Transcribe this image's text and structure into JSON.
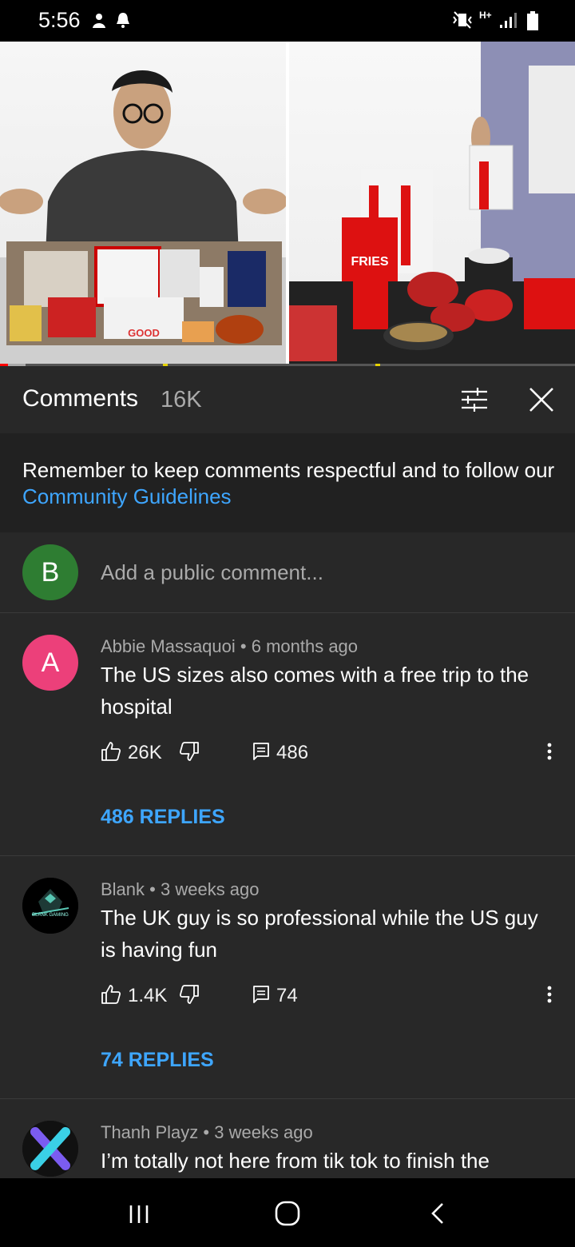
{
  "status_bar": {
    "time": "5:56",
    "network": "H+"
  },
  "video": {
    "left_panel_caption": "GOOD",
    "right_panel_caption": "FRIES",
    "played_fraction": 0.014
  },
  "comments_panel": {
    "title": "Comments",
    "count": "16K",
    "guideline_text": "Remember to keep comments respectful and to follow our ",
    "guideline_link": "Community Guidelines",
    "add_comment": {
      "avatar_letter": "B",
      "avatar_color": "#2e7d32",
      "placeholder": "Add a public comment..."
    }
  },
  "comments": [
    {
      "author": "Abbie Massaquoi",
      "time": "6 months ago",
      "text": "The US sizes also comes with a free trip to the hospital",
      "likes": "26K",
      "reply_count": "486",
      "replies_label": "486 REPLIES",
      "avatar_letter": "A",
      "avatar_color": "#ec407a"
    },
    {
      "author": "Blank",
      "time": "3 weeks ago",
      "text": "The UK guy is so professional while the US guy is having fun",
      "likes": "1.4K",
      "reply_count": "74",
      "replies_label": "74 REPLIES",
      "avatar_letter": "",
      "avatar_color": "#000000",
      "avatar_caption": "BLANK GAMING"
    },
    {
      "author": "Thanh Playz",
      "time": "3 weeks ago",
      "text": "I’m totally not here from tik tok to finish the",
      "avatar_letter": "",
      "avatar_color": "#111111"
    }
  ],
  "colors": {
    "link": "#3ea6ff",
    "background": "#282828",
    "guideline_bg": "#212121"
  }
}
